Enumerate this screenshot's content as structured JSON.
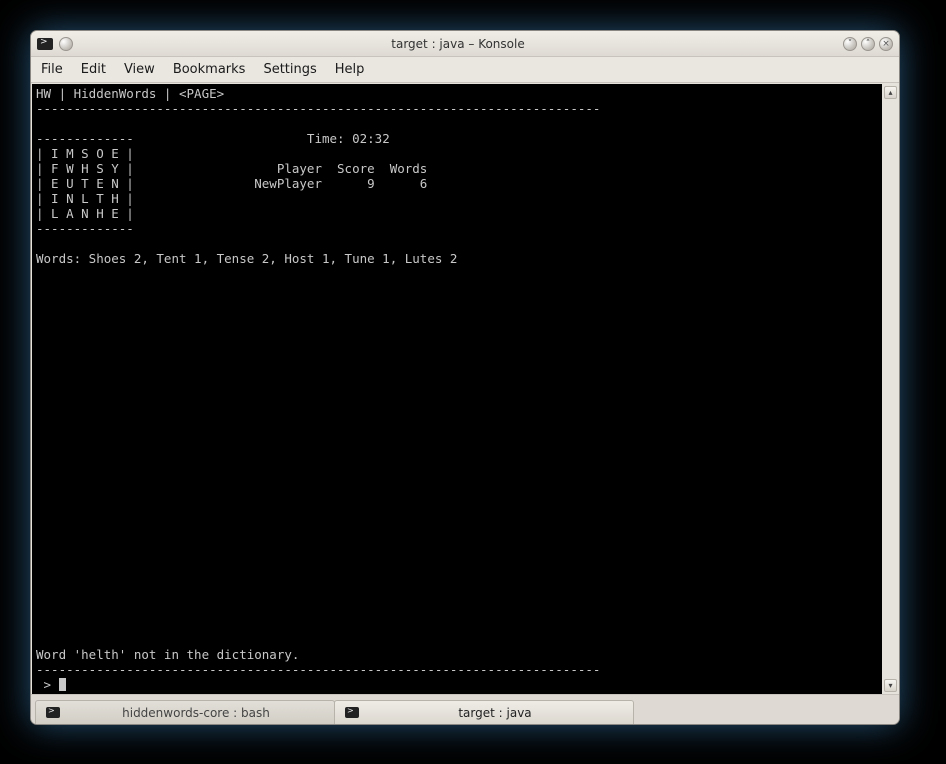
{
  "window": {
    "title": "target : java – Konsole"
  },
  "menubar": {
    "items": [
      "File",
      "Edit",
      "View",
      "Bookmarks",
      "Settings",
      "Help"
    ]
  },
  "terminal": {
    "header": "HW | HiddenWords | <PAGE>",
    "divider_long": "---------------------------------------------------------------------------",
    "divider_short": "-------------",
    "time_line": "                       Time: 02:32",
    "grid": [
      "| I M S O E |",
      "| F W H S Y |                   Player  Score  Words",
      "| E U T E N |                NewPlayer      9      6",
      "| I N L T H |",
      "| L A N H E |"
    ],
    "words_line": "Words: Shoes 2, Tent 1, Tense 2, Host 1, Tune 1, Lutes 2",
    "error_line": "Word 'helth' not in the dictionary.",
    "prompt": " > "
  },
  "tabs": [
    {
      "label": "hiddenwords-core : bash",
      "active": false
    },
    {
      "label": "target : java",
      "active": true
    }
  ]
}
